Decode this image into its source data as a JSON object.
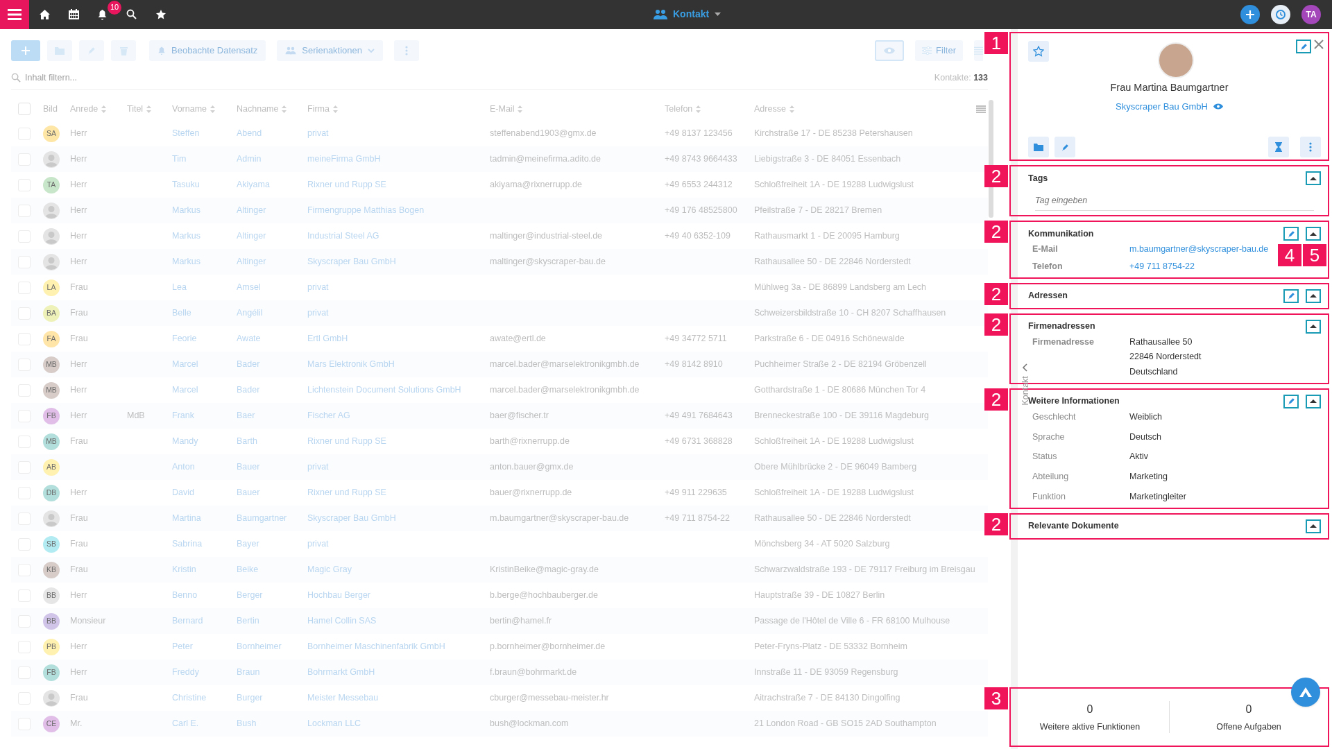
{
  "top_bar": {
    "notification_count": "10",
    "module": "Kontakt",
    "user_initials": "TA"
  },
  "toolbar": {
    "watch_button": "Beobachte Datensatz",
    "bulk_button": "Serienaktionen",
    "filter_button": "Filter"
  },
  "search": {
    "placeholder": "Inhalt filtern..."
  },
  "record_count": {
    "label": "Kontakte:",
    "value": "133"
  },
  "table": {
    "select_all_checked": false,
    "columns": [
      "Bild",
      "Anrede",
      "Titel",
      "Vorname",
      "Nachname",
      "Firma",
      "E-Mail",
      "Telefon",
      "Adresse"
    ],
    "rows": [
      {
        "checked": false,
        "avatar": {
          "kind": "initials",
          "initials": "SA",
          "color": "#fde6a6"
        },
        "salutation": "Herr",
        "first_name": "Steffen",
        "last_name": "Abend",
        "company": "privat",
        "email": "steffenabend1903@gmx.de",
        "phone": "+49 8137 123456",
        "address": "Kirchstraße 17 - DE 85238 Petershausen"
      },
      {
        "checked": false,
        "avatar": {
          "kind": "photo"
        },
        "salutation": "Herr",
        "first_name": "Tim",
        "last_name": "Admin",
        "company": "meineFirma GmbH",
        "email": "tadmin@meinefirma.adito.de",
        "phone": "+49 8743 9664433",
        "address": "Liebigstraße 3 - DE 84051 Essenbach"
      },
      {
        "checked": false,
        "avatar": {
          "kind": "initials",
          "initials": "TA",
          "color": "#c8e6c9"
        },
        "salutation": "Herr",
        "first_name": "Tasuku",
        "last_name": "Akiyama",
        "company": "Rixner und Rupp SE",
        "email": "akiyama@rixnerrupp.de",
        "phone": "+49 6553 244312",
        "address": "Schloßfreiheit 1A - DE 19288 Ludwigslust"
      },
      {
        "checked": false,
        "avatar": {
          "kind": "photo"
        },
        "salutation": "Herr",
        "first_name": "Markus",
        "last_name": "Altinger",
        "company": "Firmengruppe Matthias Bogen",
        "phone": "+49 176 48525800",
        "address": "Pfeilstraße 7 - DE 28217 Bremen"
      },
      {
        "checked": false,
        "avatar": {
          "kind": "photo"
        },
        "salutation": "Herr",
        "first_name": "Markus",
        "last_name": "Altinger",
        "company": "Industrial Steel AG",
        "email": "maltinger@industrial-steel.de",
        "phone": "+49 40 6352-109",
        "address": "Rathausmarkt 1 - DE 20095 Hamburg"
      },
      {
        "checked": false,
        "avatar": {
          "kind": "photo"
        },
        "salutation": "Herr",
        "first_name": "Markus",
        "last_name": "Altinger",
        "company": "Skyscraper Bau GmbH",
        "email": "maltinger@skyscraper-bau.de",
        "address": "Rathausallee 50 - DE 22846 Norderstedt"
      },
      {
        "checked": false,
        "avatar": {
          "kind": "initials",
          "initials": "LA",
          "color": "#fff1b0"
        },
        "salutation": "Frau",
        "first_name": "Lea",
        "last_name": "Amsel",
        "company": "privat",
        "address": "Mühlweg 3a - DE 86899 Landsberg am Lech"
      },
      {
        "checked": false,
        "avatar": {
          "kind": "initials",
          "initials": "BA",
          "color": "#eef2b8"
        },
        "salutation": "Frau",
        "first_name": "Belle",
        "last_name": "Angélil",
        "company": "privat",
        "address": "Schweizersbildstraße 10 - CH 8207 Schaffhausen"
      },
      {
        "checked": false,
        "avatar": {
          "kind": "initials",
          "initials": "FA",
          "color": "#ffe5a8"
        },
        "salutation": "Frau",
        "first_name": "Feorie",
        "last_name": "Awate",
        "company": "Ertl GmbH",
        "email": "awate@ertl.de",
        "phone": "+49 34772 5711",
        "address": "Parkstraße 6 - DE 04916 Schönewalde"
      },
      {
        "checked": false,
        "avatar": {
          "kind": "initials",
          "initials": "MB",
          "color": "#d7ccc8"
        },
        "salutation": "Herr",
        "first_name": "Marcel",
        "last_name": "Bader",
        "company": "Mars Elektronik GmbH",
        "email": "marcel.bader@marselektronikgmbh.de",
        "phone": "+49 8142 8910",
        "address": "Puchheimer Straße 2 - DE 82194 Gröbenzell"
      },
      {
        "checked": false,
        "avatar": {
          "kind": "initials",
          "initials": "MB",
          "color": "#d7ccc8"
        },
        "salutation": "Herr",
        "first_name": "Marcel",
        "last_name": "Bader",
        "company": "Lichtenstein Document Solutions GmbH",
        "email": "marcel.bader@marselektronikgmbh.de",
        "address": "Gotthardstraße 1 - DE 80686 München Tor 4"
      },
      {
        "checked": false,
        "avatar": {
          "kind": "initials",
          "initials": "FB",
          "color": "#e1bee7"
        },
        "salutation": "Herr",
        "title": "MdB",
        "first_name": "Frank",
        "last_name": "Baer",
        "company": "Fischer AG",
        "email": "baer@fischer.tr",
        "phone": "+49 491 7684643",
        "address": "Brenneckestraße 100 - DE 39116 Magdeburg"
      },
      {
        "checked": false,
        "avatar": {
          "kind": "initials",
          "initials": "MB",
          "color": "#b2dfdb"
        },
        "salutation": "Frau",
        "first_name": "Mandy",
        "last_name": "Barth",
        "company": "Rixner und Rupp SE",
        "email": "barth@rixnerrupp.de",
        "phone": "+49 6731 368828",
        "address": "Schloßfreiheit 1A - DE 19288 Ludwigslust"
      },
      {
        "checked": false,
        "avatar": {
          "kind": "initials",
          "initials": "AB",
          "color": "#fff1b0"
        },
        "first_name": "Anton",
        "last_name": "Bauer",
        "company": "privat",
        "email": "anton.bauer@gmx.de",
        "address": "Obere Mühlbrücke 2 - DE 96049 Bamberg"
      },
      {
        "checked": false,
        "avatar": {
          "kind": "initials",
          "initials": "DB",
          "color": "#b2dfdb"
        },
        "salutation": "Herr",
        "first_name": "David",
        "last_name": "Bauer",
        "company": "Rixner und Rupp SE",
        "email": "bauer@rixnerrupp.de",
        "phone": "+49 911 229635",
        "address": "Schloßfreiheit 1A - DE 19288 Ludwigslust"
      },
      {
        "checked": false,
        "avatar": {
          "kind": "photo"
        },
        "salutation": "Frau",
        "first_name": "Martina",
        "last_name": "Baumgartner",
        "company": "Skyscraper Bau GmbH",
        "email": "m.baumgartner@skyscraper-bau.de",
        "phone": "+49 711 8754-22",
        "address": "Rathausallee 50 - DE 22846 Norderstedt"
      },
      {
        "checked": false,
        "avatar": {
          "kind": "initials",
          "initials": "SB",
          "color": "#b2ebf2"
        },
        "salutation": "Frau",
        "first_name": "Sabrina",
        "last_name": "Bayer",
        "company": "privat",
        "address": "Mönchsberg 34 - AT 5020 Salzburg"
      },
      {
        "checked": false,
        "avatar": {
          "kind": "initials",
          "initials": "KB",
          "color": "#d7ccc8"
        },
        "salutation": "Frau",
        "first_name": "Kristin",
        "last_name": "Beike",
        "company": "Magic Gray",
        "email": "KristinBeike@magic-gray.de",
        "address": "Schwarzwaldstraße 193 - DE 79117 Freiburg im Breisgau"
      },
      {
        "checked": false,
        "avatar": {
          "kind": "initials",
          "initials": "BB",
          "color": "#e6e6e6"
        },
        "salutation": "Herr",
        "first_name": "Benno",
        "last_name": "Berger",
        "company": "Hochbau Berger",
        "email": "b.berge@hochbauberger.de",
        "address": "Hauptstraße 39 - DE 10827 Berlin"
      },
      {
        "checked": false,
        "avatar": {
          "kind": "initials",
          "initials": "BB",
          "color": "#d1c4e9"
        },
        "salutation": "Monsieur",
        "first_name": "Bernard",
        "last_name": "Bertin",
        "company": "Hamel Collin SAS",
        "email": "bertin@hamel.fr",
        "address": "Passage de l'Hôtel de Ville 6 - FR 68100 Mulhouse"
      },
      {
        "checked": false,
        "avatar": {
          "kind": "initials",
          "initials": "PB",
          "color": "#fff1b0"
        },
        "salutation": "Herr",
        "first_name": "Peter",
        "last_name": "Bornheimer",
        "company": "Bornheimer Maschinenfabrik GmbH",
        "email": "p.bornheimer@bornheimer.de",
        "address": "Peter-Fryns-Platz - DE 53332 Bornheim"
      },
      {
        "checked": false,
        "avatar": {
          "kind": "initials",
          "initials": "FB",
          "color": "#b2dfdb"
        },
        "salutation": "Herr",
        "first_name": "Freddy",
        "last_name": "Braun",
        "company": "Bohrmarkt GmbH",
        "email": "f.braun@bohrmarkt.de",
        "address": "Innstraße 11 - DE 93059 Regensburg"
      },
      {
        "checked": false,
        "avatar": {
          "kind": "photo"
        },
        "salutation": "Frau",
        "first_name": "Christine",
        "last_name": "Burger",
        "company": "Meister Messebau",
        "email": "cburger@messebau-meister.hr",
        "address": "Aitrachstraße 7 - DE 84130 Dingolfing"
      },
      {
        "checked": false,
        "avatar": {
          "kind": "initials",
          "initials": "CE",
          "color": "#e1bee7"
        },
        "salutation": "Mr.",
        "first_name": "Carl E.",
        "last_name": "Bush",
        "company": "Lockman LLC",
        "email": "bush@lockman.com",
        "address": "21 London Road - GB SO15 2AD Southampton"
      }
    ]
  },
  "detail": {
    "annotation": "1",
    "name": "Frau Martina Baumgartner",
    "company": "Skyscraper Bau GmbH",
    "side_tab": "Kontakt",
    "sections": [
      {
        "annotation": "2",
        "kind": "tags",
        "title": "Tags",
        "editable": false,
        "placeholder": "Tag eingeben"
      },
      {
        "annotation": "2",
        "kind": "fields",
        "title": "Kommunikation",
        "editable": true,
        "bold_labels": true,
        "button_annotations": [
          "4",
          "5"
        ],
        "fields": [
          {
            "label": "E-Mail",
            "value": [
              "m.baumgartner@skyscraper-bau.de"
            ],
            "link": true
          },
          {
            "label": "Telefon",
            "value": [
              "+49 711 8754-22"
            ],
            "link": true
          }
        ]
      },
      {
        "annotation": "2",
        "kind": "fields",
        "title": "Adressen",
        "editable": true
      },
      {
        "annotation": "2",
        "kind": "fields",
        "title": "Firmenadressen",
        "editable": false,
        "bold_labels": true,
        "fields": [
          {
            "label": "Firmenadresse",
            "value": [
              "Rathausallee 50",
              "22846 Norderstedt",
              "Deutschland"
            ],
            "link": false
          }
        ]
      },
      {
        "annotation": "2",
        "kind": "fields",
        "title": "Weitere Informationen",
        "editable": true,
        "bold_labels": false,
        "fields": [
          {
            "label": "Geschlecht",
            "value": [
              "Weiblich"
            ],
            "link": false
          },
          {
            "label": "Sprache",
            "value": [
              "Deutsch"
            ],
            "link": false
          },
          {
            "label": "Status",
            "value": [
              "Aktiv"
            ],
            "link": false
          },
          {
            "label": "Abteilung",
            "value": [
              "Marketing"
            ],
            "link": false
          },
          {
            "label": "Funktion",
            "value": [
              "Marketingleiter"
            ],
            "link": false
          }
        ]
      },
      {
        "annotation": "2",
        "kind": "fields",
        "title": "Relevante Dokumente",
        "editable": false
      }
    ],
    "stats": {
      "annotation": "3",
      "items": [
        {
          "value": "0",
          "label": "Weitere aktive Funktionen"
        },
        {
          "value": "0",
          "label": "Offene Aufgaben"
        }
      ]
    }
  }
}
